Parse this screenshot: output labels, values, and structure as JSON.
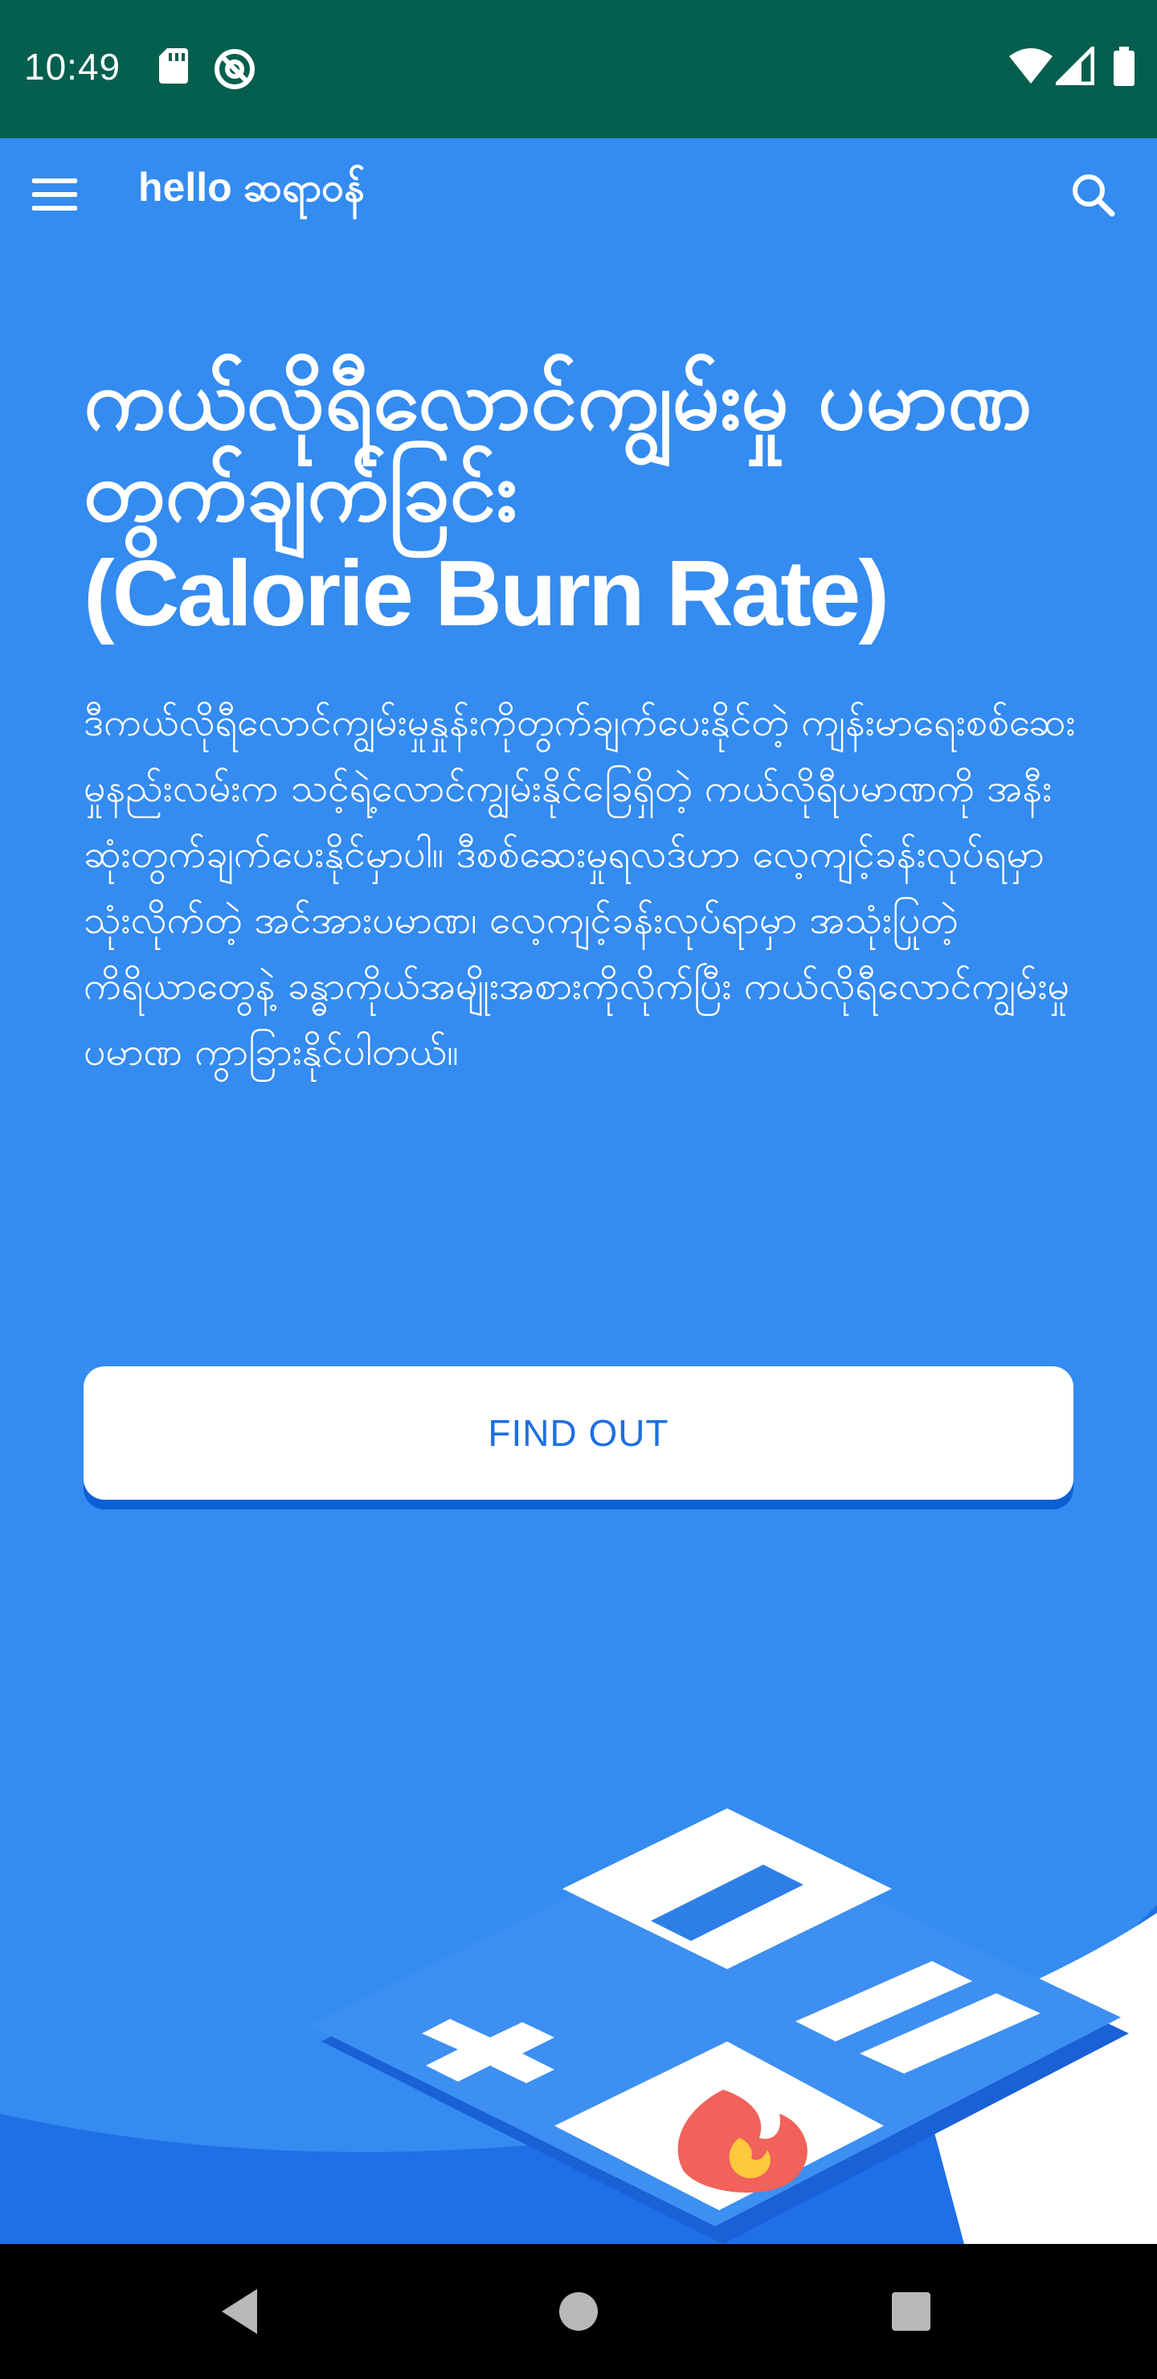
{
  "status_bar": {
    "time": "10:49",
    "icons": [
      "sd-card-icon",
      "at-sign-icon",
      "wifi-icon",
      "signal-icon",
      "battery-icon"
    ]
  },
  "app_bar": {
    "brand": "hello ဆရာဝန်",
    "menu_icon": "hamburger-menu-icon",
    "search_icon": "search-icon"
  },
  "main": {
    "title": "ကယ်လိုရီလောင်ကျွမ်းမှု ပမာဏတွက်ချက်ခြင်း",
    "title_en": "(Calorie Burn Rate)",
    "description": "ဒီကယ်လိုရီလောင်ကျွမ်းမှုနှုန်းကိုတွက်ချက်ပေးနိုင်တဲ့ ကျန်းမာရေးစစ်ဆေးမှုနည်းလမ်းက သင့်ရဲ့လောင်ကျွမ်းနိုင်ခြေရှိတဲ့ ကယ်လိုရီပမာဏကို အနီးဆုံးတွက်ချက်ပေးနိုင်မှာပါ။ ဒီစစ်ဆေးမှုရလဒ်ဟာ လေ့ကျင့်ခန်းလုပ်ရမှာသုံးလိုက်တဲ့ အင်အားပမာဏ၊ လေ့ကျင့်ခန်းလုပ်ရာမှာ အသုံးပြုတဲ့ ကိရိယာတွေနဲ့ ခန္ဓာကိုယ်အမျိုးအစားကိုလိုက်ပြီး ကယ်လိုရီလောင်ကျွမ်းမှုပမာဏ ကွာခြားနိုင်ပါတယ်။",
    "button_label": "FIND OUT"
  },
  "colors": {
    "status_bar": "#055f4e",
    "primary": "#348bf0",
    "button_text": "#1f6fe0",
    "flame_outer": "#f0625a",
    "flame_inner": "#ffc83d"
  },
  "nav_bar": {
    "buttons": [
      "back-icon",
      "home-icon",
      "recents-icon"
    ]
  }
}
